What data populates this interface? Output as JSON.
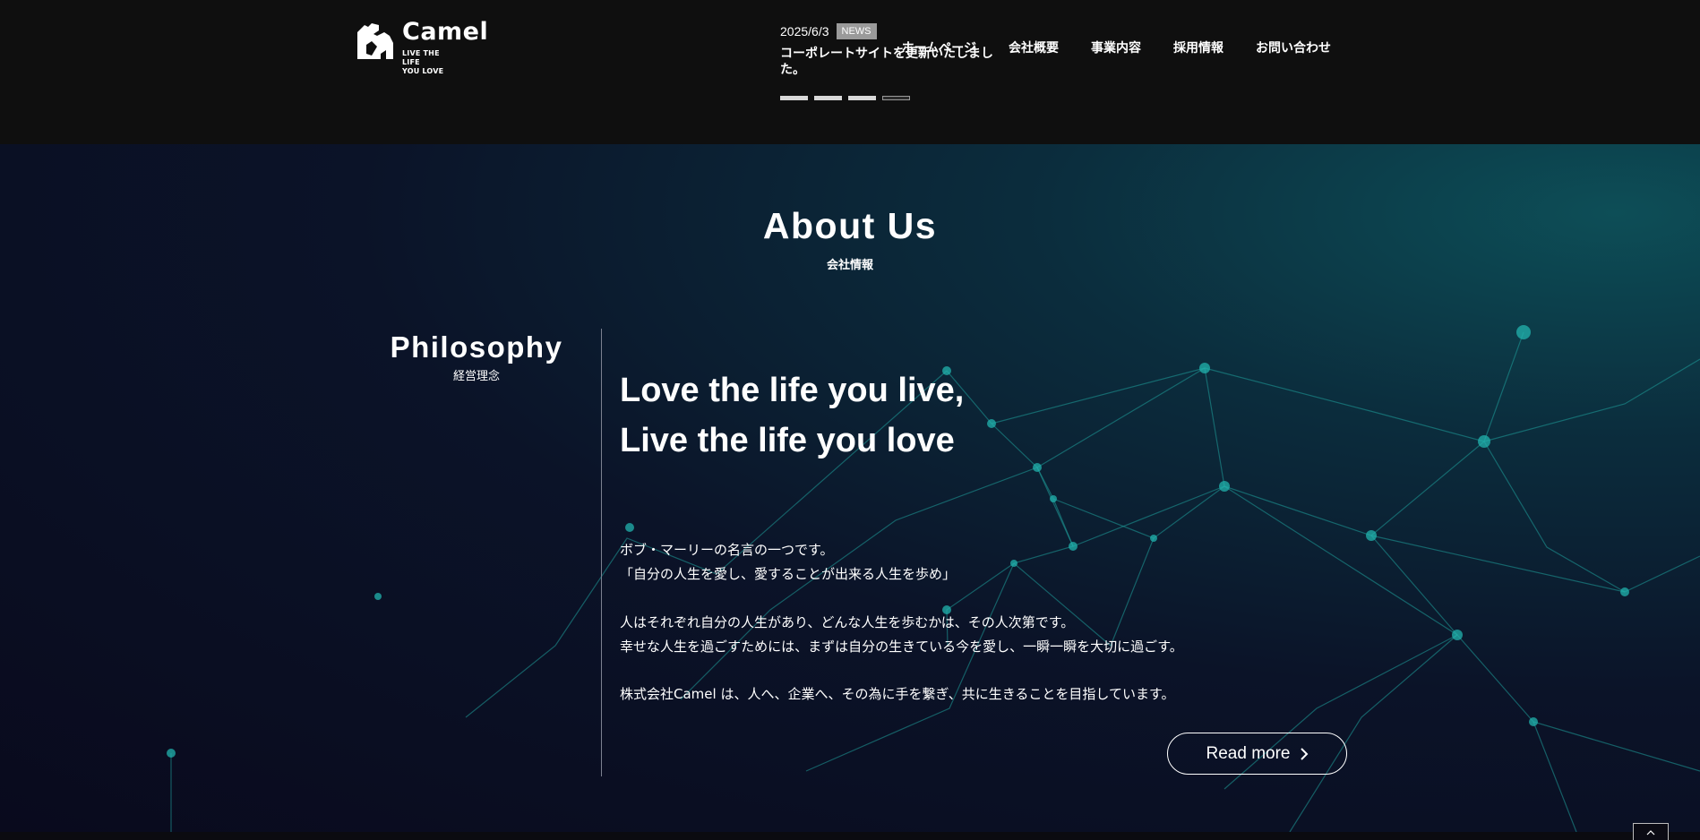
{
  "brand": {
    "name": "Camel",
    "tagline": "LIVE THE\nLIFE\nYOU LOVE",
    "logo_icon": "camel-icon"
  },
  "news": {
    "date": "2025/6/3",
    "badge": "NEWS",
    "title": "コーポレートサイトを更新いたしました。",
    "slide_count": 4,
    "active_slide": 4
  },
  "nav": {
    "items": [
      "ホームページ",
      "会社概要",
      "事業内容",
      "採用情報",
      "お問い合わせ"
    ]
  },
  "about": {
    "title": "About Us",
    "subtitle": "会社情報"
  },
  "philosophy": {
    "title": "Philosophy",
    "subtitle": "経営理念",
    "lead_line1": "Love the life you live,",
    "lead_line2": "Live the life you love",
    "paragraphs": [
      "ボブ・マーリーの名言の一つです。",
      "「自分の人生を愛し、愛することが出来る人生を歩め」",
      "人はそれぞれ自分の人生があり、どんな人生を歩むかは、その人次第です。",
      "幸せな人生を過ごすためには、まずは自分の生きている今を愛し、一瞬一瞬を大切に過ごす。",
      "株式会社Camel は、人へ、企業へ、その為に手を繋ぎ、共に生きることを目指しています。"
    ],
    "read_more": "Read more"
  },
  "colors": {
    "header_bg": "#0f0f0f",
    "section_bg": "#090a1d",
    "network_accent": "#1a8f8f",
    "badge_bg": "#9a9a9a"
  }
}
